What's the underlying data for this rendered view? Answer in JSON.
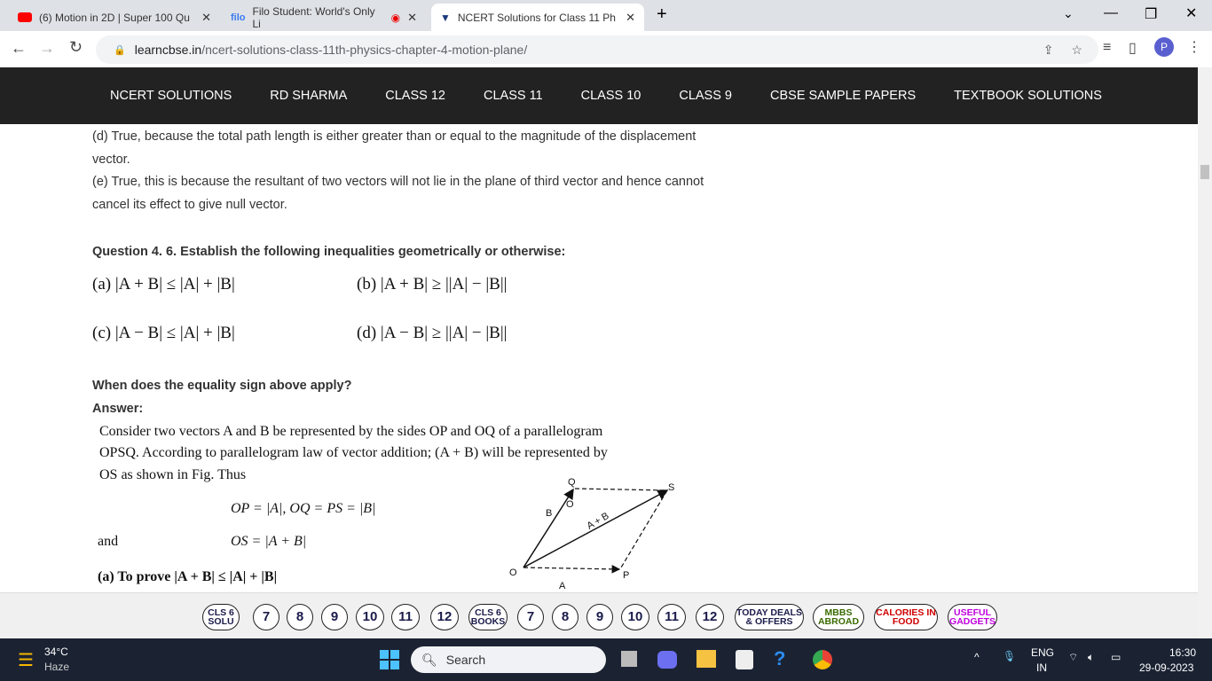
{
  "browser": {
    "tabs": [
      {
        "title": "(6) Motion in 2D | Super 100 Qu",
        "icon": "youtube-icon"
      },
      {
        "title": "Filo Student: World's Only Li",
        "icon": "filo-icon",
        "badge": "filo"
      },
      {
        "title": "NCERT Solutions for Class 11 Ph",
        "icon": "learncbse-icon"
      }
    ],
    "url_domain": "learncbse.in",
    "url_path": "/ncert-solutions-class-11th-physics-chapter-4-motion-plane/",
    "profile_initial": "P"
  },
  "nav": [
    "NCERT SOLUTIONS",
    "RD SHARMA",
    "CLASS 12",
    "CLASS 11",
    "CLASS 10",
    "CLASS 9",
    "CBSE SAMPLE PAPERS",
    "TEXTBOOK SOLUTIONS"
  ],
  "content": {
    "d_line1": "(d) True, because the total path length is either greater than or equal to the magnitude of the displacement",
    "d_line2": "vector.",
    "e_line1": "(e) True, this is because the resultant of two vectors will not lie in the plane of third vector and hence cannot",
    "e_line2": "cancel its effect to give null vector.",
    "question": "Question 4. 6. Establish the following inequalities geometrically or otherwise:",
    "ineq": [
      "(a) |A + B| ≤ |A| + |B|",
      "(b) |A + B| ≥ ||A| − |B||",
      "(c) |A − B| ≤ |A| + |B|",
      "(d) |A − B| ≥ ||A| − |B||"
    ],
    "when": "When does the equality sign above apply?",
    "answer": "Answer:",
    "ans1": "Consider two vectors A and B be represented by the sides OP and OQ of a parallelogram",
    "ans2": "OPSQ. According to parallelogram law of vector addition; (A + B) will be represented by",
    "ans3": "OS  as shown in Fig. Thus",
    "eq1": "OP  =  |A|,   OQ = PS = |B|",
    "and": "and",
    "eq2": "OS  =  |A + B|",
    "prove": "(a)  To prove |A + B| ≤ |A| + |B|",
    "fig": {
      "O": "O",
      "P": "P",
      "Q": "Q",
      "S": "S",
      "A": "A",
      "B": "B",
      "AB": "A + B",
      "o": "O"
    }
  },
  "adbar": [
    "CLS 6 SOLU",
    "7",
    "8",
    "9",
    "10",
    "11",
    "12",
    "CLS 6 BOOKS",
    "7",
    "8",
    "9",
    "10",
    "11",
    "12",
    "TODAY DEALS & OFFERS",
    "MBBS ABROAD",
    "CALORIES IN FOOD",
    "USEFUL GADGETS"
  ],
  "adcolors": {
    "MBBS ABROAD": "#3a6b00",
    "CALORIES IN FOOD": "#d00000",
    "USEFUL GADGETS": "#c000e0"
  },
  "taskbar": {
    "temp": "34°C",
    "weather": "Haze",
    "search": "Search",
    "lang1": "ENG",
    "lang2": "IN",
    "time": "16:30",
    "date": "29-09-2023"
  }
}
